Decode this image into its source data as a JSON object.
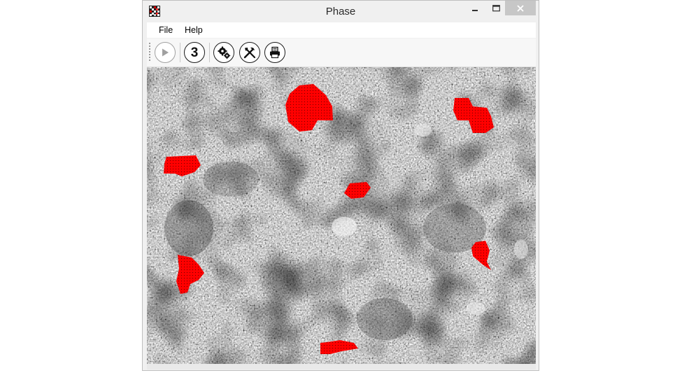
{
  "window": {
    "title": "Phase"
  },
  "menu": {
    "file": "File",
    "help": "Help"
  },
  "toolbar": {
    "run_enabled": false,
    "count_label": "3",
    "icons": [
      "play-icon",
      "number-three-icon",
      "gears-icon",
      "tools-icon",
      "printer-icon"
    ]
  },
  "colors": {
    "detected_phase": "#ff0000",
    "close_button_bg": "#c7c7c7",
    "chrome_bg": "#f0f0f0"
  }
}
